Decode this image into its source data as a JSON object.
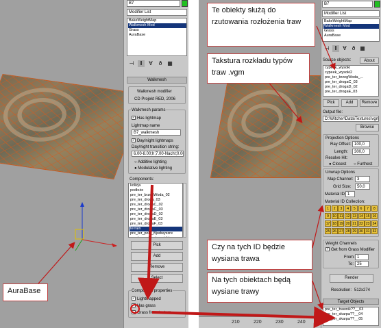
{
  "left": {
    "name_field": "B7",
    "modifier_list": "Modifier List",
    "stack": [
      {
        "label": "BakeWeightMap",
        "selected": false
      },
      {
        "label": "Walkmesh Mod",
        "selected": true
      },
      {
        "label": "Grass",
        "selected": false
      },
      {
        "label": "AuraBase",
        "selected": false
      }
    ],
    "rollout_title": "Walkmesh",
    "about_line1": "Walkmesh modifier",
    "about_line2": "CD Projekt RED, 2006",
    "params_group": "Walkmesh params",
    "has_lightmap": "Has lightmap",
    "lightmap_name_label": "Lightmap name",
    "lightmap_name_value": "B7_walkmesh",
    "day_night": "Day/night lightmaps",
    "transition_label": "Day/night transition string:",
    "transition_value": "6.00-8.00;h;7.00-Nacht;0.00-Noc",
    "additive": "Additive lighting",
    "modulative": "Modulative lighting",
    "components_label": "Components:",
    "components": [
      "kolizja",
      "podłoże",
      "pre_ter_brzegWoda_02",
      "pre_ter_droga_03",
      "pre_ter_drogaC_02",
      "pre_ter_drogaC_03",
      "pre_ter_drogaD_02",
      "pre_ter_drogaE_03",
      "pre_ter_drogaF_03",
      "terrain",
      "pre_ter_pola_Bjodwyszre",
      "pre_ter_pola_ziemniaki"
    ],
    "selected_component": "terrain",
    "pick_btn": "Pick",
    "add_btn": "Add",
    "remove_btn": "Remove",
    "select_btn": "Select",
    "comp_props_group": "Component properties",
    "lightmapped": "Lightmapped",
    "has_grass": "Has grass",
    "grass_from_texture": "Grass from texture"
  },
  "right": {
    "name_field": "B7",
    "modifier_list": "Modifier List",
    "stack": [
      {
        "label": "BakeWeightMap",
        "selected": false
      },
      {
        "label": "Walkmesh Mod",
        "selected": true
      },
      {
        "label": "Grass",
        "selected": false
      },
      {
        "label": "AuraBase",
        "selected": false
      }
    ],
    "source_objects_label": "Source objects:",
    "about_label": "About",
    "source_objects": [
      "cypeek_wysoki",
      "cypeek_wysoki2",
      "pre_ter_brzegWoda_...",
      "pre_ter_drogaC_03",
      "pre_ter_drogaD_02",
      "pre_ter_drogaE_03"
    ],
    "pick_btn": "Pick",
    "add_btn": "Add",
    "remove_btn": "Remove",
    "output_file_label": "Output file:",
    "output_file_value": "D:\\Witcher\\Data\\Textures\\vgm",
    "browse_btn": "Browse",
    "projection_group": "Projection Options",
    "ray_offset_label": "Ray Offset:",
    "ray_offset_value": "100,0",
    "length_label": "Length:",
    "length_value": "300,0",
    "resolve_label": "Resolve Hit:",
    "closest": "Closest",
    "furthest": "Furthest",
    "unwrap_group": "Unwrap Options",
    "map_channel_label": "Map Channel:",
    "map_channel_value": "3",
    "grid_size_label": "Grid Size:",
    "grid_size_value": "50,0",
    "material_id_label": "Material ID:",
    "material_id_value": "1",
    "material_collection_label": "Material ID Collection:",
    "id_cells": [
      "1",
      "2",
      "3",
      "4",
      "5",
      "6",
      "7",
      "8",
      "9",
      "10",
      "11",
      "12",
      "13",
      "14",
      "15",
      "16",
      "17",
      "18",
      "19",
      "20",
      "21",
      "22",
      "23",
      "24",
      "25",
      "26",
      "27",
      "28",
      "29",
      "30",
      "31",
      "32"
    ],
    "weight_group": "Weight Channels",
    "get_from_grass": "Get from Grass Modifier",
    "from_label": "From:",
    "from_value": "1",
    "to_label": "To:",
    "to_value": "25",
    "render_btn": "Render",
    "resolution_label": "Resolution:",
    "resolution_value": "512x274",
    "target_objects_rollout": "Target Objects",
    "target_objects": [
      "pre_ter_trawnik??__03",
      "pre_ter_skarpa??__04",
      "pre_ter_skarpa??__05"
    ]
  },
  "ruler": [
    "210",
    "220",
    "230",
    "240"
  ],
  "callouts": {
    "c1": "Te obiekty służą do rzutowania rozłożenia traw",
    "c2": "Takstura rozkładu typów traw .vgm",
    "c3": "Czy na tych ID będzie wysiana trawa",
    "c4": "Na tych obiektach będą wysiane trawy",
    "c5": "AuraBase"
  },
  "colors": {
    "callout_border": "#c04040",
    "arrow": "#c01818",
    "selection": "#14357a",
    "id_cell": "#e8c23a"
  }
}
